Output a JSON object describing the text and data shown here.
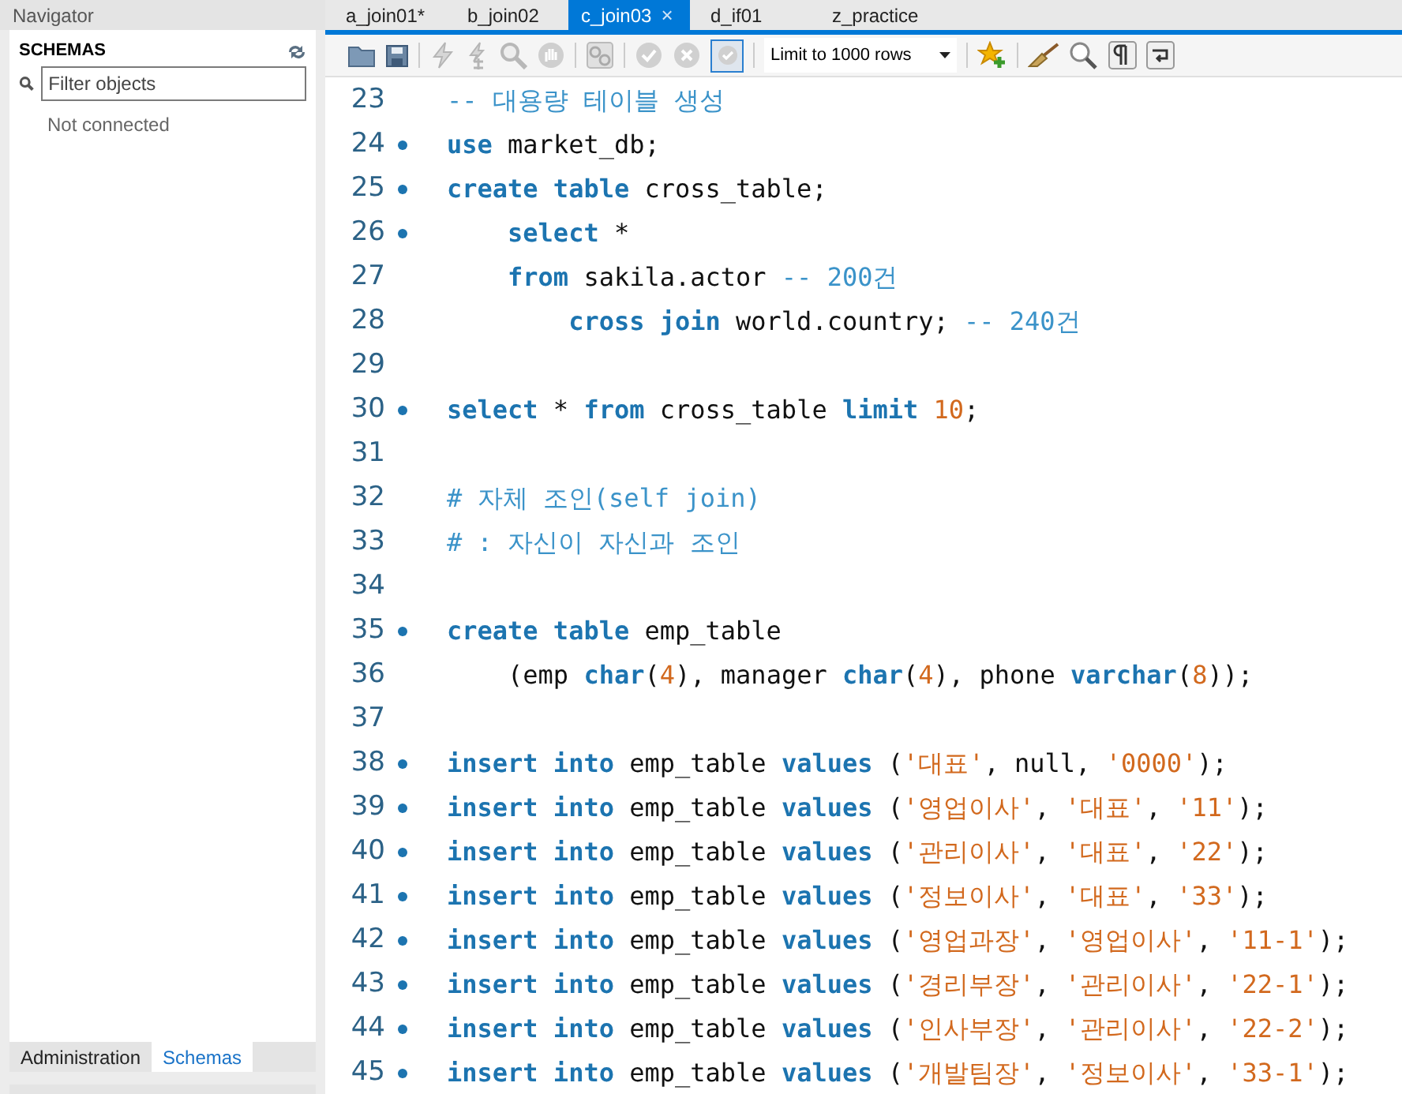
{
  "navigator": {
    "title": "Navigator",
    "schemas_title": "SCHEMAS",
    "filter": {
      "placeholder": "Filter objects"
    },
    "status": "Not connected",
    "bottom_tabs": [
      {
        "label": "Administration",
        "selected": false
      },
      {
        "label": "Schemas",
        "selected": true
      }
    ]
  },
  "tabs": [
    {
      "label": "a_join01*",
      "selected": false
    },
    {
      "label": "b_join02",
      "selected": false
    },
    {
      "label": "c_join03",
      "selected": true,
      "close": "×"
    },
    {
      "label": "d_if01",
      "selected": false
    },
    {
      "label": "z_practice",
      "selected": false
    }
  ],
  "toolbar": {
    "limit": "Limit to 1000 rows",
    "autocommit": true
  },
  "editor": {
    "lines": [
      {
        "number": "23",
        "statement": false,
        "tokens": [
          {
            "kind": "comment",
            "text": "-- 대용량 테이블 생성"
          }
        ]
      },
      {
        "number": "24",
        "statement": true,
        "tokens": [
          {
            "kind": "keyword",
            "text": "use"
          },
          {
            "kind": "plain",
            "text": " market_db;"
          }
        ]
      },
      {
        "number": "25",
        "statement": true,
        "tokens": [
          {
            "kind": "keyword",
            "text": "create table"
          },
          {
            "kind": "plain",
            "text": " cross_table;"
          }
        ]
      },
      {
        "number": "26",
        "statement": true,
        "tokens": [
          {
            "kind": "keyword",
            "text": "    select"
          },
          {
            "kind": "plain",
            "text": " *"
          }
        ]
      },
      {
        "number": "27",
        "statement": false,
        "tokens": [
          {
            "kind": "keyword",
            "text": "    from"
          },
          {
            "kind": "plain",
            "text": " sakila.actor "
          },
          {
            "kind": "comment",
            "text": "-- 200건"
          }
        ]
      },
      {
        "number": "28",
        "statement": false,
        "tokens": [
          {
            "kind": "keyword",
            "text": "        cross join"
          },
          {
            "kind": "plain",
            "text": " world.country; "
          },
          {
            "kind": "comment",
            "text": "-- 240건"
          }
        ]
      },
      {
        "number": "29",
        "statement": false
      },
      {
        "number": "30",
        "statement": true,
        "tokens": [
          {
            "kind": "keyword",
            "text": "select"
          },
          {
            "kind": "plain",
            "text": " * "
          },
          {
            "kind": "keyword",
            "text": "from"
          },
          {
            "kind": "plain",
            "text": " cross_table "
          },
          {
            "kind": "keyword",
            "text": "limit"
          },
          {
            "kind": "number",
            "text": " 10"
          },
          {
            "kind": "plain",
            "text": ";"
          }
        ]
      },
      {
        "number": "31",
        "statement": false
      },
      {
        "number": "32",
        "statement": false,
        "tokens": [
          {
            "kind": "comment",
            "text": "# 자체 조인(self join)"
          }
        ]
      },
      {
        "number": "33",
        "statement": false,
        "tokens": [
          {
            "kind": "comment",
            "text": "# : 자신이 자신과 조인"
          }
        ]
      },
      {
        "number": "34",
        "statement": false
      },
      {
        "number": "35",
        "statement": true,
        "tokens": [
          {
            "kind": "keyword",
            "text": "create table"
          },
          {
            "kind": "plain",
            "text": " emp_table"
          }
        ]
      },
      {
        "number": "36",
        "statement": false,
        "tokens": [
          {
            "kind": "plain",
            "text": "    (emp "
          },
          {
            "kind": "keyword",
            "text": "char"
          },
          {
            "kind": "plain",
            "text": "("
          },
          {
            "kind": "number",
            "text": "4"
          },
          {
            "kind": "plain",
            "text": "), manager "
          },
          {
            "kind": "keyword",
            "text": "char"
          },
          {
            "kind": "plain",
            "text": "("
          },
          {
            "kind": "number",
            "text": "4"
          },
          {
            "kind": "plain",
            "text": "), phone "
          },
          {
            "kind": "keyword",
            "text": "varchar"
          },
          {
            "kind": "plain",
            "text": "("
          },
          {
            "kind": "number",
            "text": "8"
          },
          {
            "kind": "plain",
            "text": "));"
          }
        ]
      },
      {
        "number": "37",
        "statement": false
      },
      {
        "number": "38",
        "statement": true,
        "tokens": [
          {
            "kind": "keyword",
            "text": "insert into"
          },
          {
            "kind": "plain",
            "text": " emp_table "
          },
          {
            "kind": "keyword",
            "text": "values"
          },
          {
            "kind": "plain",
            "text": " ("
          },
          {
            "kind": "string",
            "text": "'대표'"
          },
          {
            "kind": "plain",
            "text": ", null, "
          },
          {
            "kind": "string",
            "text": "'0000'"
          },
          {
            "kind": "plain",
            "text": ");"
          }
        ]
      },
      {
        "number": "39",
        "statement": true,
        "tokens": [
          {
            "kind": "keyword",
            "text": "insert into"
          },
          {
            "kind": "plain",
            "text": " emp_table "
          },
          {
            "kind": "keyword",
            "text": "values"
          },
          {
            "kind": "plain",
            "text": " ("
          },
          {
            "kind": "string",
            "text": "'영업이사'"
          },
          {
            "kind": "plain",
            "text": ", "
          },
          {
            "kind": "string",
            "text": "'대표'"
          },
          {
            "kind": "plain",
            "text": ", "
          },
          {
            "kind": "string",
            "text": "'11'"
          },
          {
            "kind": "plain",
            "text": ");"
          }
        ]
      },
      {
        "number": "40",
        "statement": true,
        "tokens": [
          {
            "kind": "keyword",
            "text": "insert into"
          },
          {
            "kind": "plain",
            "text": " emp_table "
          },
          {
            "kind": "keyword",
            "text": "values"
          },
          {
            "kind": "plain",
            "text": " ("
          },
          {
            "kind": "string",
            "text": "'관리이사'"
          },
          {
            "kind": "plain",
            "text": ", "
          },
          {
            "kind": "string",
            "text": "'대표'"
          },
          {
            "kind": "plain",
            "text": ", "
          },
          {
            "kind": "string",
            "text": "'22'"
          },
          {
            "kind": "plain",
            "text": ");"
          }
        ]
      },
      {
        "number": "41",
        "statement": true,
        "tokens": [
          {
            "kind": "keyword",
            "text": "insert into"
          },
          {
            "kind": "plain",
            "text": " emp_table "
          },
          {
            "kind": "keyword",
            "text": "values"
          },
          {
            "kind": "plain",
            "text": " ("
          },
          {
            "kind": "string",
            "text": "'정보이사'"
          },
          {
            "kind": "plain",
            "text": ", "
          },
          {
            "kind": "string",
            "text": "'대표'"
          },
          {
            "kind": "plain",
            "text": ", "
          },
          {
            "kind": "string",
            "text": "'33'"
          },
          {
            "kind": "plain",
            "text": ");"
          }
        ]
      },
      {
        "number": "42",
        "statement": true,
        "tokens": [
          {
            "kind": "keyword",
            "text": "insert into"
          },
          {
            "kind": "plain",
            "text": " emp_table "
          },
          {
            "kind": "keyword",
            "text": "values"
          },
          {
            "kind": "plain",
            "text": " ("
          },
          {
            "kind": "string",
            "text": "'영업과장'"
          },
          {
            "kind": "plain",
            "text": ", "
          },
          {
            "kind": "string",
            "text": "'영업이사'"
          },
          {
            "kind": "plain",
            "text": ", "
          },
          {
            "kind": "string",
            "text": "'11-1'"
          },
          {
            "kind": "plain",
            "text": ");"
          }
        ]
      },
      {
        "number": "43",
        "statement": true,
        "tokens": [
          {
            "kind": "keyword",
            "text": "insert into"
          },
          {
            "kind": "plain",
            "text": " emp_table "
          },
          {
            "kind": "keyword",
            "text": "values"
          },
          {
            "kind": "plain",
            "text": " ("
          },
          {
            "kind": "string",
            "text": "'경리부장'"
          },
          {
            "kind": "plain",
            "text": ", "
          },
          {
            "kind": "string",
            "text": "'관리이사'"
          },
          {
            "kind": "plain",
            "text": ", "
          },
          {
            "kind": "string",
            "text": "'22-1'"
          },
          {
            "kind": "plain",
            "text": ");"
          }
        ]
      },
      {
        "number": "44",
        "statement": true,
        "tokens": [
          {
            "kind": "keyword",
            "text": "insert into"
          },
          {
            "kind": "plain",
            "text": " emp_table "
          },
          {
            "kind": "keyword",
            "text": "values"
          },
          {
            "kind": "plain",
            "text": " ("
          },
          {
            "kind": "string",
            "text": "'인사부장'"
          },
          {
            "kind": "plain",
            "text": ", "
          },
          {
            "kind": "string",
            "text": "'관리이사'"
          },
          {
            "kind": "plain",
            "text": ", "
          },
          {
            "kind": "string",
            "text": "'22-2'"
          },
          {
            "kind": "plain",
            "text": ");"
          }
        ]
      },
      {
        "number": "45",
        "statement": true,
        "tokens": [
          {
            "kind": "keyword",
            "text": "insert into"
          },
          {
            "kind": "plain",
            "text": " emp_table "
          },
          {
            "kind": "keyword",
            "text": "values"
          },
          {
            "kind": "plain",
            "text": " ("
          },
          {
            "kind": "string",
            "text": "'개발팀장'"
          },
          {
            "kind": "plain",
            "text": ", "
          },
          {
            "kind": "string",
            "text": "'정보이사'"
          },
          {
            "kind": "plain",
            "text": ", "
          },
          {
            "kind": "string",
            "text": "'33-1'"
          },
          {
            "kind": "plain",
            "text": ");"
          }
        ]
      }
    ]
  }
}
